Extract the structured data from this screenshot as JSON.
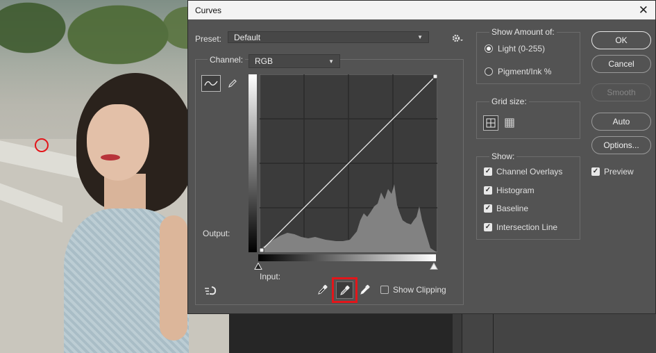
{
  "dialog": {
    "title": "Curves",
    "close_glyph": "✕"
  },
  "preset": {
    "label": "Preset:",
    "value": "Default"
  },
  "channel": {
    "label": "Channel:",
    "value": "RGB"
  },
  "graph": {
    "output_label": "Output:",
    "input_label": "Input:"
  },
  "show_clipping": {
    "label": "Show Clipping",
    "checked": false
  },
  "show_amount": {
    "title": "Show Amount of:",
    "options": [
      {
        "label": "Light  (0-255)",
        "selected": true
      },
      {
        "label": "Pigment/Ink %",
        "selected": false
      }
    ]
  },
  "grid_size": {
    "title": "Grid size:"
  },
  "show": {
    "title": "Show:",
    "items": [
      {
        "label": "Channel Overlays",
        "checked": true
      },
      {
        "label": "Histogram",
        "checked": true
      },
      {
        "label": "Baseline",
        "checked": true
      },
      {
        "label": "Intersection Line",
        "checked": true
      }
    ]
  },
  "buttons": {
    "ok": "OK",
    "cancel": "Cancel",
    "smooth": "Smooth",
    "auto": "Auto",
    "options": "Options..."
  },
  "preview": {
    "label": "Preview",
    "checked": true
  },
  "colors": {
    "dialog_bg": "#535353",
    "highlight": "#e3151a"
  },
  "icons": [
    "gear-icon",
    "curve-tool-icon",
    "pencil-icon",
    "on-image-adjust-icon",
    "black-point-eyedropper-icon",
    "gray-point-eyedropper-icon",
    "white-point-eyedropper-icon",
    "simple-grid-icon",
    "detailed-grid-icon"
  ]
}
